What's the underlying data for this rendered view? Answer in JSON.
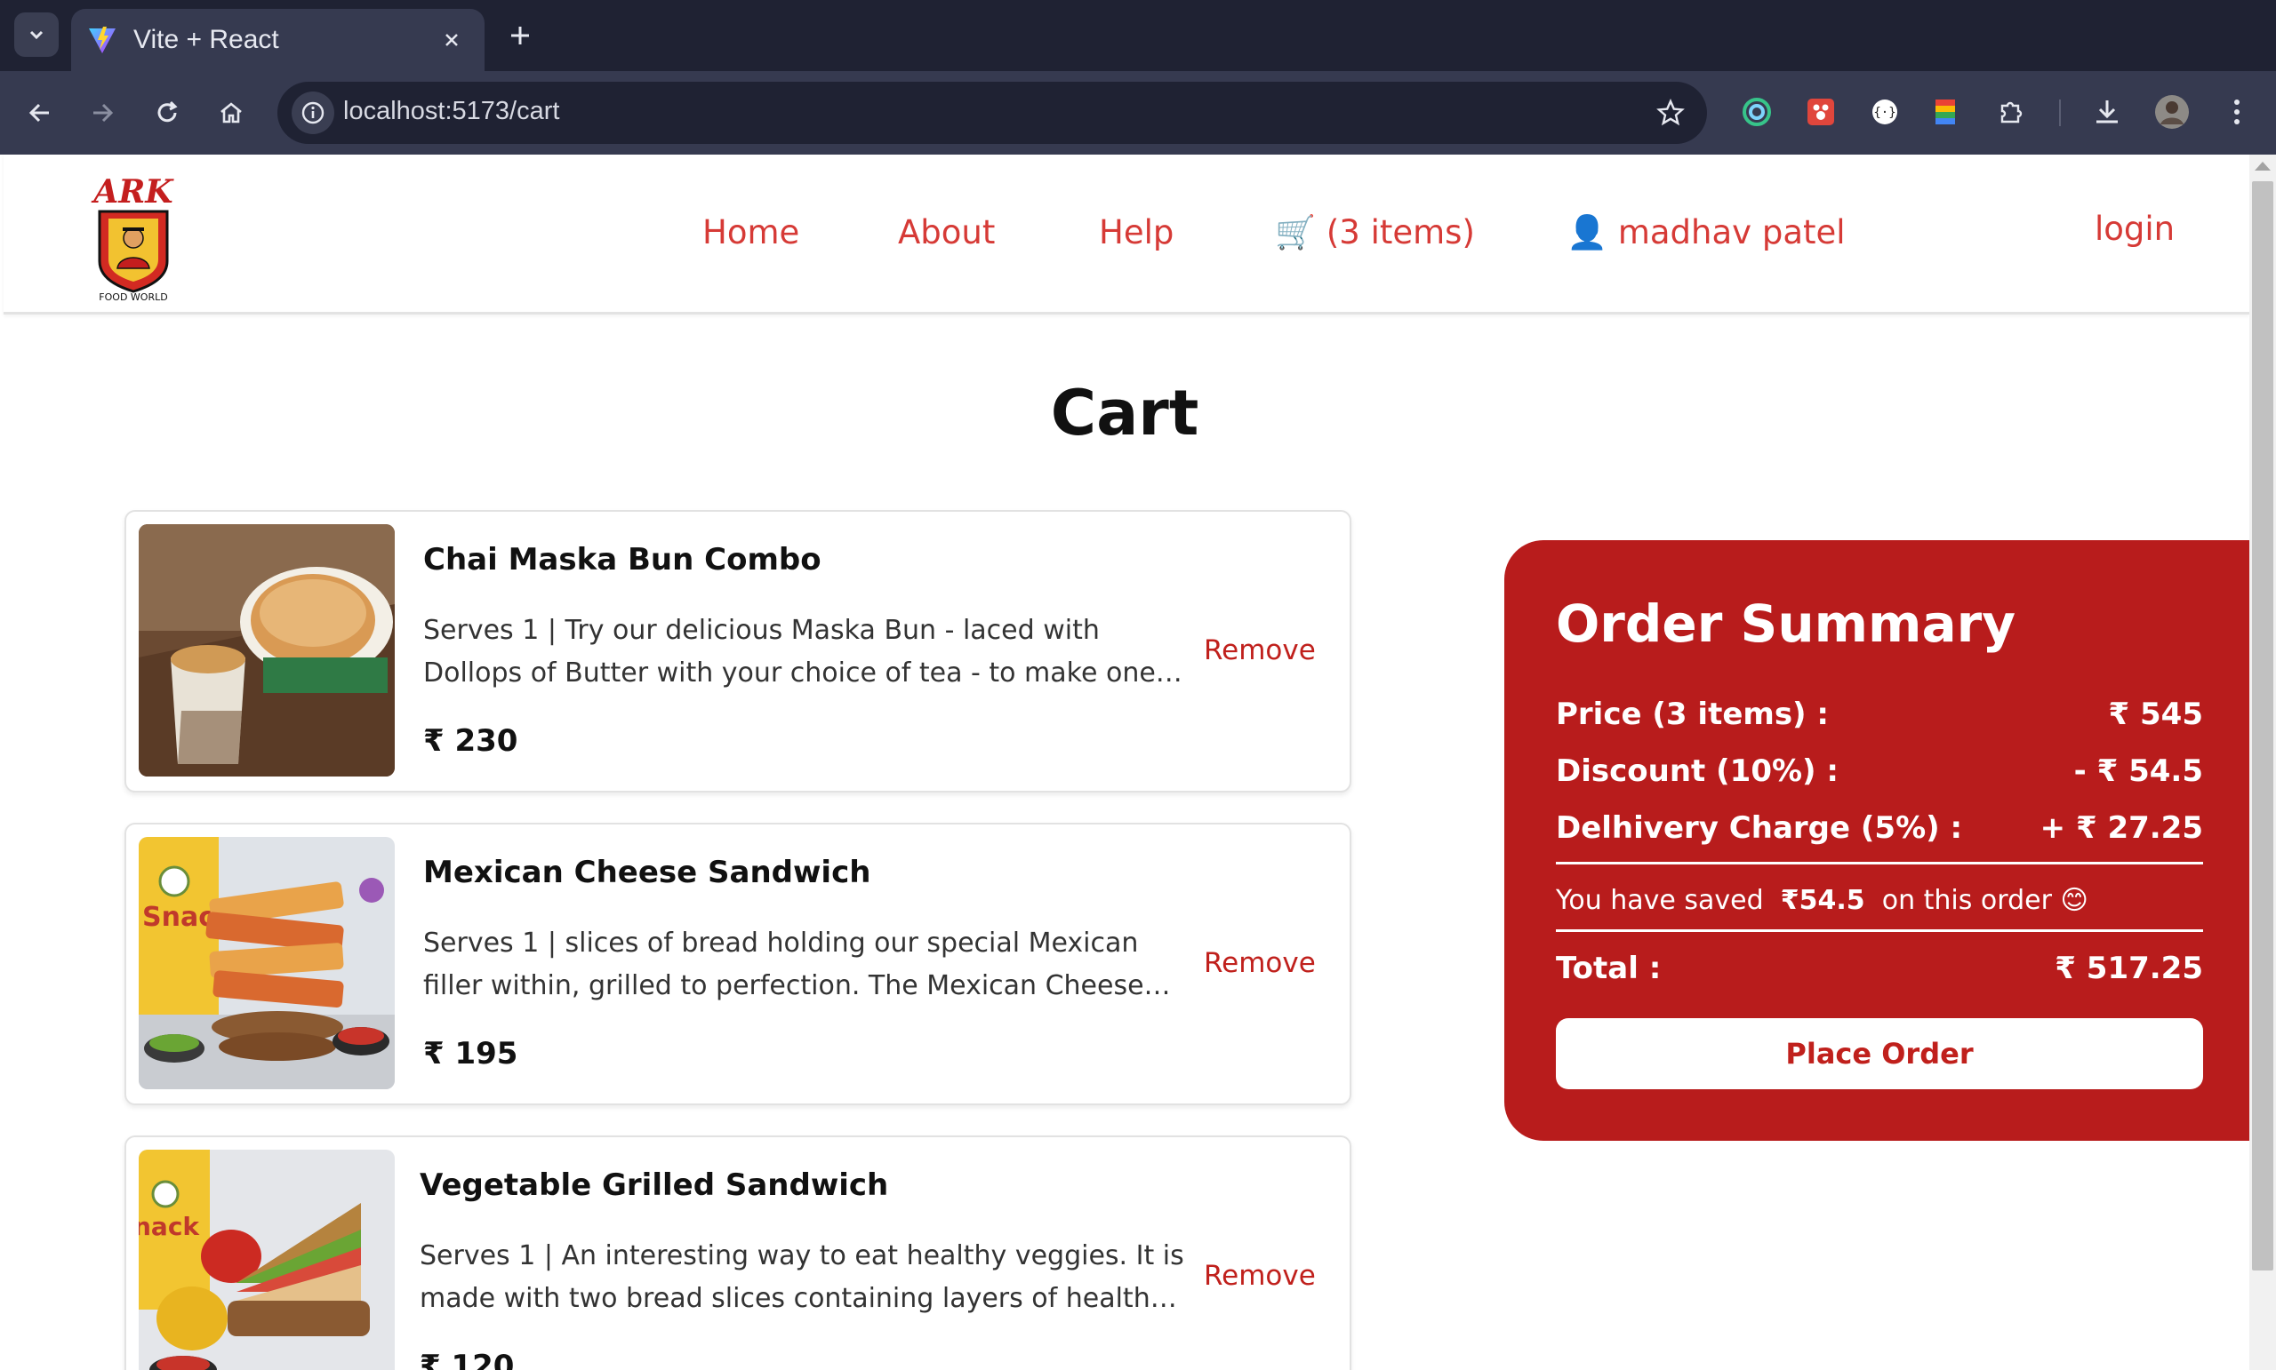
{
  "browser": {
    "tab_title": "Vite + React",
    "url": "localhost:5173/cart"
  },
  "header": {
    "logo_text": "ARK",
    "logo_subtext": "FOOD WORLD",
    "nav": {
      "home": "Home",
      "about": "About",
      "help": "Help",
      "cart_icon": "🛒",
      "cart": "(3 items)",
      "user_icon": "👤",
      "user": "madhav patel",
      "login": "login"
    }
  },
  "page": {
    "title": "Cart"
  },
  "cart_items": [
    {
      "name": "Chai Maska Bun Combo",
      "description": "Serves 1 | Try our delicious Maska Bun - laced with Dollops of Butter with your choice of tea - to make one happy",
      "price": "₹ 230",
      "remove_label": "Remove"
    },
    {
      "name": "Mexican Cheese Sandwich",
      "description": "Serves 1 | slices of bread holding our special Mexican filler within, grilled to perfection. The Mexican Cheese Sandwich",
      "price": "₹ 195",
      "remove_label": "Remove"
    },
    {
      "name": "Vegetable Grilled Sandwich",
      "description": "Serves 1 | An interesting way to eat healthy veggies. It is made with two bread slices containing layers of healthy veggies",
      "price": "₹ 120",
      "remove_label": "Remove"
    }
  ],
  "summary": {
    "title": "Order Summary",
    "price_label": "Price (3 items) :",
    "price_value": "₹ 545",
    "discount_label": "Discount (10%) :",
    "discount_value": "- ₹ 54.5",
    "delivery_label": "Delhivery Charge (5%) :",
    "delivery_value": "+ ₹ 27.25",
    "saved_prefix": "You have saved",
    "saved_amount": "₹54.5",
    "saved_suffix": "on this order 😊",
    "total_label": "Total :",
    "total_value": "₹ 517.25",
    "place_order": "Place Order"
  },
  "colors": {
    "brand_red": "#b81c1c",
    "nav_red": "#d63a36",
    "chrome_dark": "#1f2233",
    "chrome_mid": "#363a50"
  }
}
